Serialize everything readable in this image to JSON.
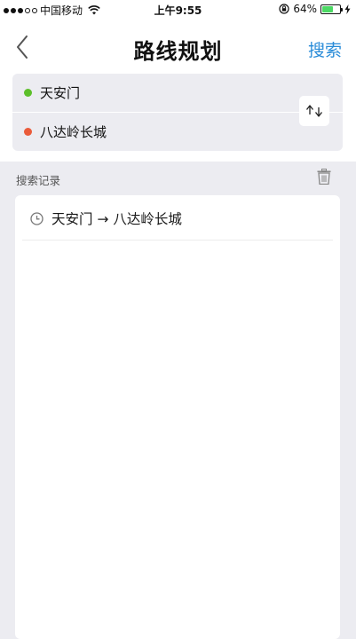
{
  "status_bar": {
    "carrier": "中国移动",
    "time": "上午9:55",
    "battery_percent": "64%",
    "battery_level": 0.64,
    "battery_color": "#4cd964",
    "icons": [
      "signal-dots-icon",
      "wifi-icon",
      "rotation-lock-icon",
      "battery-icon",
      "charging-icon"
    ]
  },
  "nav": {
    "title": "路线规划",
    "search_label": "搜索",
    "back_icon": "chevron-left-icon",
    "accent_color": "#2a8cd8"
  },
  "route": {
    "start": {
      "label": "天安门",
      "dot_color": "#5cbf2a"
    },
    "end": {
      "label": "八达岭长城",
      "dot_color": "#ea5b3a"
    },
    "swap_icon": "swap-arrows-icon"
  },
  "history": {
    "title": "搜索记录",
    "clear_icon": "trash-icon",
    "items": [
      {
        "text": "天安门 → 八达岭长城",
        "icon": "clock-icon"
      }
    ]
  }
}
